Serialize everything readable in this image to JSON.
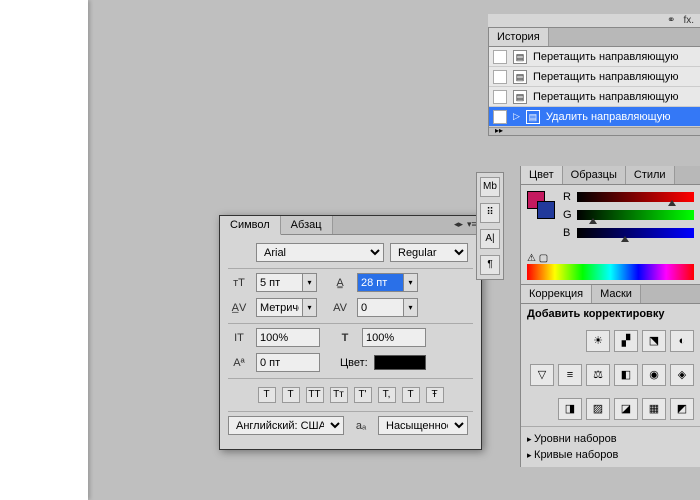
{
  "char_panel": {
    "tabs": [
      "Символ",
      "Абзац"
    ],
    "font": "Arial",
    "style": "Regular",
    "size": "5 пт",
    "leading": "28 пт",
    "kerning": "Метрическ",
    "tracking": "0",
    "vscale": "100%",
    "hscale": "100%",
    "baseline": "0 пт",
    "color_label": "Цвет:",
    "style_buttons": [
      "T",
      "T",
      "TT",
      "Tт",
      "T'",
      "T,",
      "T",
      "Ŧ"
    ],
    "language": "Английский: США",
    "anti_alias": "Насыщенное"
  },
  "history": {
    "tab": "История",
    "items": [
      "Перетащить направляющую",
      "Перетащить направляющую",
      "Перетащить направляющую",
      "Удалить направляющую"
    ]
  },
  "color_panel": {
    "tabs": [
      "Цвет",
      "Образцы",
      "Стили"
    ],
    "channels": [
      "R",
      "G",
      "B"
    ]
  },
  "adjustments": {
    "tabs": [
      "Коррекция",
      "Маски"
    ],
    "heading": "Добавить корректировку",
    "presets": [
      "Уровни наборов",
      "Кривые наборов"
    ]
  },
  "icon_strip": {
    "link": "⚭",
    "fx": "fx."
  }
}
